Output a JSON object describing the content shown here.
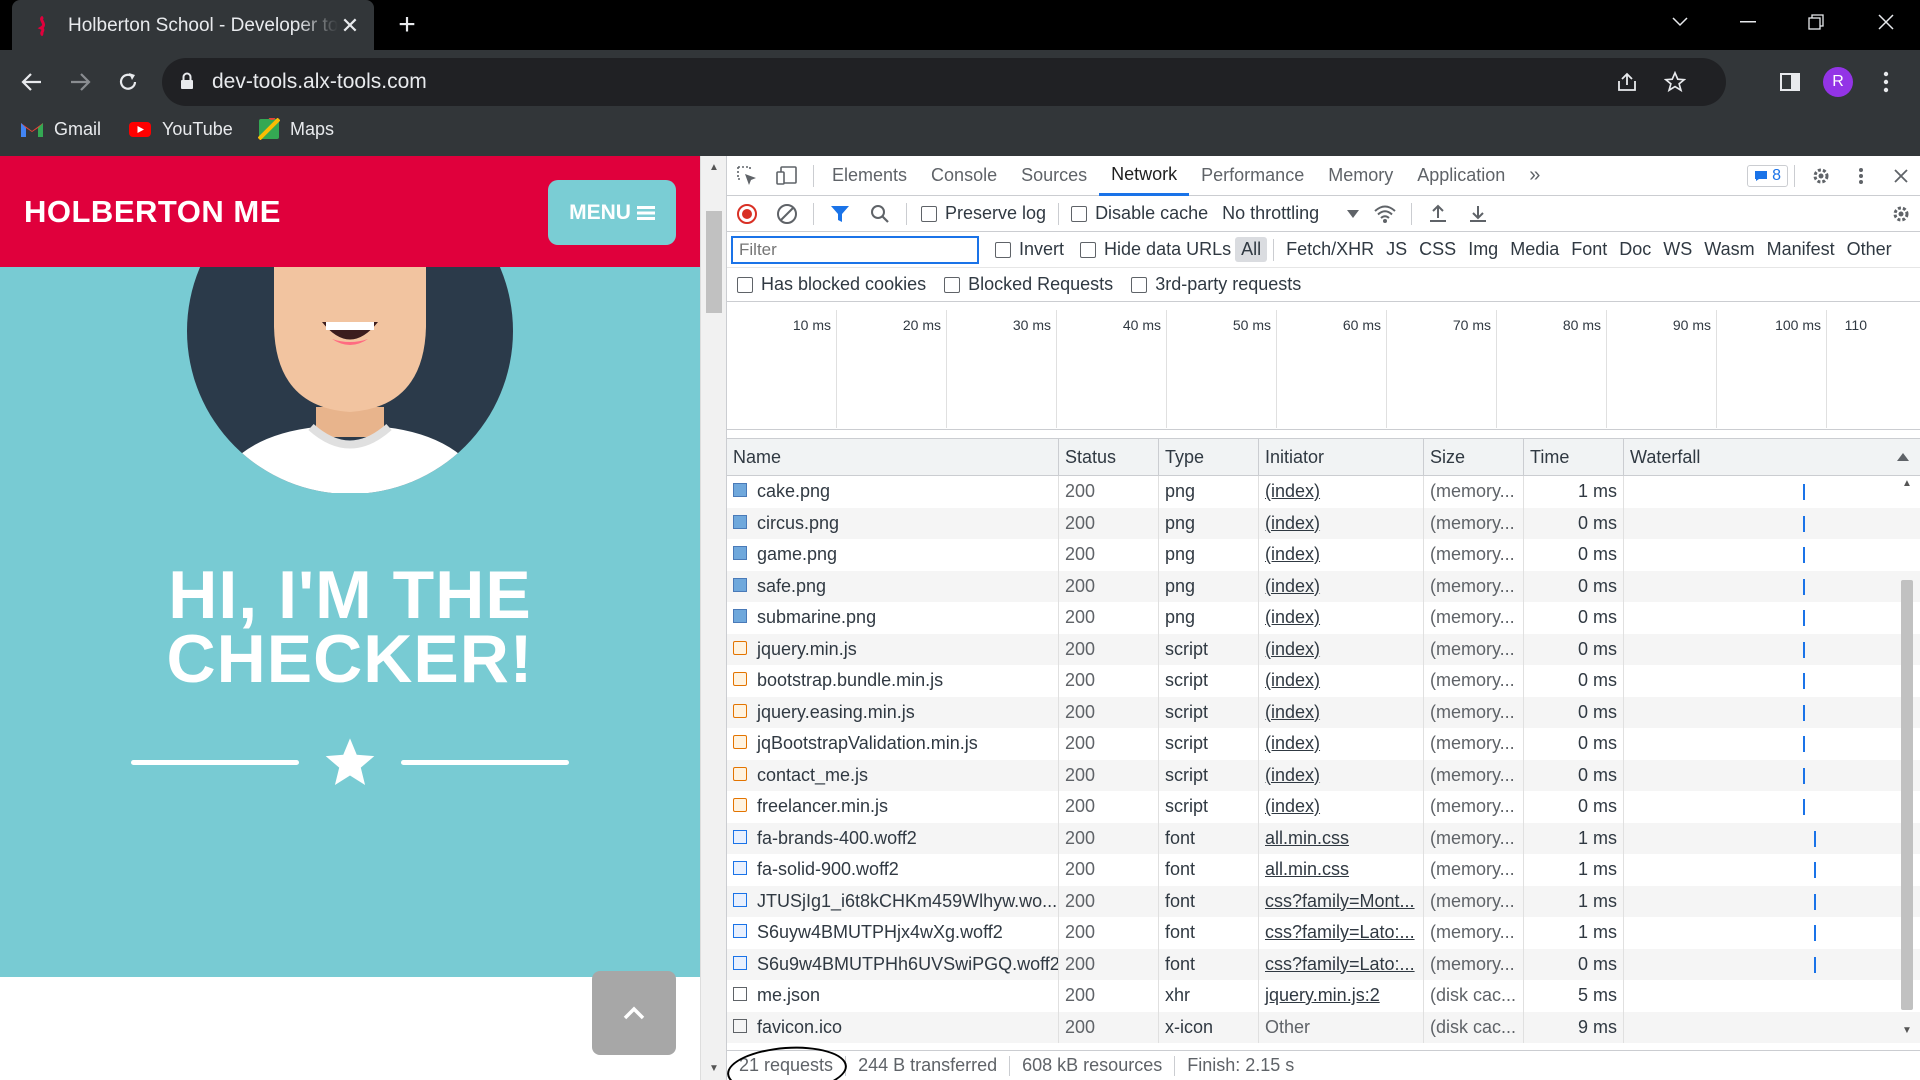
{
  "browser": {
    "tab_title": "Holberton School - Developer tools",
    "url": "dev-tools.alx-tools.com",
    "profile_initial": "R",
    "bookmarks": [
      {
        "label": "Gmail"
      },
      {
        "label": "YouTube"
      },
      {
        "label": "Maps"
      }
    ]
  },
  "page": {
    "brand": "HOLBERTON ME",
    "menu_label": "MENU",
    "hero_title_line1": "HI, I'M THE",
    "hero_title_line2": "CHECKER!",
    "colors": {
      "navbar": "#e0003c",
      "hero": "#78cbd3",
      "menu_button": "#7acdd4"
    }
  },
  "devtools": {
    "tabs": [
      "Elements",
      "Console",
      "Sources",
      "Network",
      "Performance",
      "Memory",
      "Application"
    ],
    "active_tab": "Network",
    "issues_count": "8",
    "network_bar": {
      "preserve_log": "Preserve log",
      "disable_cache": "Disable cache",
      "throttling": "No throttling"
    },
    "filter_placeholder": "Filter",
    "filter_options": {
      "invert": "Invert",
      "hide_data_urls": "Hide data URLs"
    },
    "types": [
      "All",
      "Fetch/XHR",
      "JS",
      "CSS",
      "Img",
      "Media",
      "Font",
      "Doc",
      "WS",
      "Wasm",
      "Manifest",
      "Other"
    ],
    "active_type": "All",
    "block_options": [
      "Has blocked cookies",
      "Blocked Requests",
      "3rd-party requests"
    ],
    "timeline_ticks": [
      "10 ms",
      "20 ms",
      "30 ms",
      "40 ms",
      "50 ms",
      "60 ms",
      "70 ms",
      "80 ms",
      "90 ms",
      "100 ms",
      "110"
    ],
    "columns": [
      "Name",
      "Status",
      "Type",
      "Initiator",
      "Size",
      "Time",
      "Waterfall"
    ],
    "rows": [
      {
        "name": "cake.png",
        "status": "200",
        "type": "png",
        "initiator": "(index)",
        "size": "(memory...",
        "time": "1 ms",
        "icon": "image-icon",
        "wf": 0.44
      },
      {
        "name": "circus.png",
        "status": "200",
        "type": "png",
        "initiator": "(index)",
        "size": "(memory...",
        "time": "0 ms",
        "icon": "image-icon",
        "wf": 0.44
      },
      {
        "name": "game.png",
        "status": "200",
        "type": "png",
        "initiator": "(index)",
        "size": "(memory...",
        "time": "0 ms",
        "icon": "image-icon",
        "wf": 0.44
      },
      {
        "name": "safe.png",
        "status": "200",
        "type": "png",
        "initiator": "(index)",
        "size": "(memory...",
        "time": "0 ms",
        "icon": "image-icon",
        "wf": 0.44
      },
      {
        "name": "submarine.png",
        "status": "200",
        "type": "png",
        "initiator": "(index)",
        "size": "(memory...",
        "time": "0 ms",
        "icon": "image-icon",
        "wf": 0.44
      },
      {
        "name": "jquery.min.js",
        "status": "200",
        "type": "script",
        "initiator": "(index)",
        "size": "(memory...",
        "time": "0 ms",
        "icon": "script-icon",
        "wf": 0.44
      },
      {
        "name": "bootstrap.bundle.min.js",
        "status": "200",
        "type": "script",
        "initiator": "(index)",
        "size": "(memory...",
        "time": "0 ms",
        "icon": "script-icon",
        "wf": 0.44
      },
      {
        "name": "jquery.easing.min.js",
        "status": "200",
        "type": "script",
        "initiator": "(index)",
        "size": "(memory...",
        "time": "0 ms",
        "icon": "script-icon",
        "wf": 0.44
      },
      {
        "name": "jqBootstrapValidation.min.js",
        "status": "200",
        "type": "script",
        "initiator": "(index)",
        "size": "(memory...",
        "time": "0 ms",
        "icon": "script-icon",
        "wf": 0.44
      },
      {
        "name": "contact_me.js",
        "status": "200",
        "type": "script",
        "initiator": "(index)",
        "size": "(memory...",
        "time": "0 ms",
        "icon": "script-icon",
        "wf": 0.44
      },
      {
        "name": "freelancer.min.js",
        "status": "200",
        "type": "script",
        "initiator": "(index)",
        "size": "(memory...",
        "time": "0 ms",
        "icon": "script-icon",
        "wf": 0.44
      },
      {
        "name": "fa-brands-400.woff2",
        "status": "200",
        "type": "font",
        "initiator": "all.min.css",
        "size": "(memory...",
        "time": "1 ms",
        "icon": "font-icon",
        "wf": 0.48
      },
      {
        "name": "fa-solid-900.woff2",
        "status": "200",
        "type": "font",
        "initiator": "all.min.css",
        "size": "(memory...",
        "time": "1 ms",
        "icon": "font-icon",
        "wf": 0.48
      },
      {
        "name": "JTUSjIg1_i6t8kCHKm459Wlhyw.wo...",
        "status": "200",
        "type": "font",
        "initiator": "css?family=Mont...",
        "size": "(memory...",
        "time": "1 ms",
        "icon": "font-icon",
        "wf": 0.48
      },
      {
        "name": "S6uyw4BMUTPHjx4wXg.woff2",
        "status": "200",
        "type": "font",
        "initiator": "css?family=Lato:...",
        "size": "(memory...",
        "time": "1 ms",
        "icon": "font-icon",
        "wf": 0.48
      },
      {
        "name": "S6u9w4BMUTPHh6UVSwiPGQ.woff2",
        "status": "200",
        "type": "font",
        "initiator": "css?family=Lato:...",
        "size": "(memory...",
        "time": "0 ms",
        "icon": "font-icon",
        "wf": 0.48
      },
      {
        "name": "me.json",
        "status": "200",
        "type": "xhr",
        "initiator": "jquery.min.js:2",
        "size": "(disk cac...",
        "time": "5 ms",
        "icon": "document-icon",
        "wf": null
      },
      {
        "name": "favicon.ico",
        "status": "200",
        "type": "x-icon",
        "initiator": "Other",
        "size": "(disk cac...",
        "time": "9 ms",
        "icon": "document-icon",
        "wf": null
      }
    ],
    "status_bar": {
      "requests": "21 requests",
      "transferred": "244 B transferred",
      "resources": "608 kB resources",
      "finish": "Finish: 2.15 s"
    }
  }
}
